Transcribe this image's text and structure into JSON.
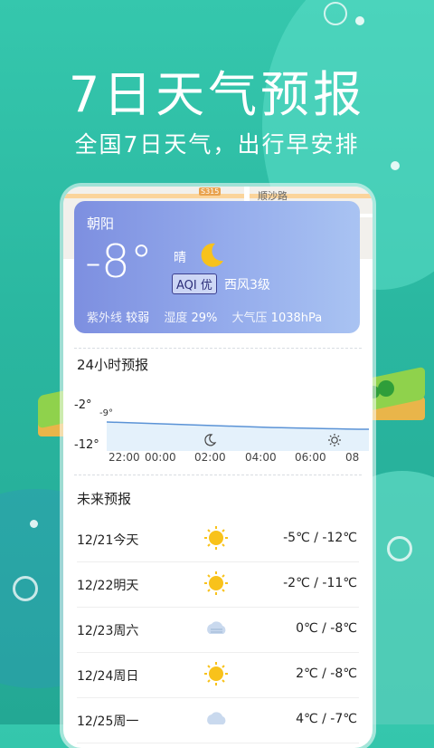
{
  "promo": {
    "headline": "7日天气预报",
    "subline": "全国7日天气，出行早安排"
  },
  "map": {
    "road_label": "顺沙路",
    "badge": "S315"
  },
  "current": {
    "city": "朝阳",
    "temperature": "-8°",
    "condition": "晴",
    "condition_icon": "moon-icon",
    "aqi_badge": "AQI 优",
    "wind": "西风3级",
    "uv_label": "紫外线",
    "uv_value": "较弱",
    "humidity_label": "湿度",
    "humidity_value": "29%",
    "pressure_label": "大气压",
    "pressure_value": "1038hPa"
  },
  "hourly": {
    "title": "24小时预报",
    "y_high": "-2°",
    "y_low": "-12°",
    "current_marker": "-9°",
    "times": [
      "22:00",
      "00:00",
      "02:00",
      "04:00",
      "06:00",
      "08"
    ],
    "icons": [
      "moon-icon",
      "sun-icon"
    ]
  },
  "forecast": {
    "title": "未来预报",
    "days": [
      {
        "date": "12/21今天",
        "icon": "sun-icon",
        "range": "-5℃ / -12℃"
      },
      {
        "date": "12/22明天",
        "icon": "sun-icon",
        "range": "-2℃ / -11℃"
      },
      {
        "date": "12/23周六",
        "icon": "cloud-icon",
        "range": "0℃ / -8℃"
      },
      {
        "date": "12/24周日",
        "icon": "sun-icon",
        "range": "2℃ / -8℃"
      },
      {
        "date": "12/25周一",
        "icon": "cloud-icon",
        "range": "4℃ / -7℃"
      }
    ]
  },
  "colors": {
    "background": "#2ab7a0",
    "card_gradient_start": "#7d8fe0",
    "card_gradient_end": "#a9c3f2",
    "sun": "#f8c21b",
    "moon": "#f7c21c"
  }
}
